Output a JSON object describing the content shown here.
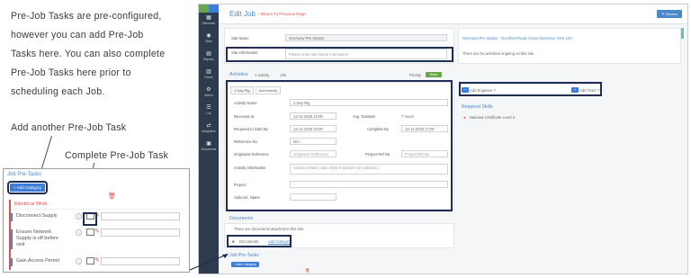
{
  "intro": {
    "lines": [
      "Pre-Job Tasks are pre-configured,",
      "however you can add Pre-Job",
      "Tasks here. You can also complete",
      "Pre-Job Tasks here prior to",
      "scheduling each Job."
    ]
  },
  "callouts": {
    "add": "Add another Pre-Job Task",
    "complete": "Complete Pre-Job Task"
  },
  "zoom": {
    "header": "Job Pre-Tasks",
    "add_button": "+ Add Category",
    "category": "Electrical Work",
    "tasks": [
      {
        "label": "Disconnect Supply"
      },
      {
        "label": "Ensure Network Supply is off before visit"
      },
      {
        "label": "Gain Access Permit"
      }
    ]
  },
  "app": {
    "sidebar": [
      {
        "icon": "calendar-icon",
        "glyph": "▦",
        "label": "Scheduler"
      },
      {
        "icon": "gauge-icon",
        "glyph": "◉",
        "label": "Sites"
      },
      {
        "icon": "report-icon",
        "glyph": "▤",
        "label": "Reports"
      },
      {
        "icon": "form-icon",
        "glyph": "▥",
        "label": "Forms"
      },
      {
        "icon": "admin-icon",
        "glyph": "⚙",
        "label": "Admin"
      },
      {
        "icon": "list-icon",
        "glyph": "☰",
        "label": "List"
      },
      {
        "icon": "integration-icon",
        "glyph": "⇄",
        "label": "Integration"
      },
      {
        "icon": "document-icon",
        "glyph": "▣",
        "label": "Documents"
      }
    ],
    "title": "Edit Job",
    "back_link": "‹ Return To Previous Page",
    "review_button": "✎ Review",
    "site_name_label": "Site Name",
    "site_name_value": "Overview Pre Station",
    "site_info_label": "Site Information",
    "site_info_placeholder": "Please enter Site Name information",
    "site_address": "Overview Pre Station - Overfield Road, Great Overview, OV9 1XX",
    "activities_note": "There are No activities ongoing on this site.",
    "activities_heading": "Activities",
    "activities_meta": "1 activity",
    "activities_count": "130",
    "priority_label": "Priority",
    "save_button": "Save",
    "tab_label": "1 Day Rig",
    "add_activity": "Add Activity",
    "form": {
      "activity_name_label": "Activity Name",
      "activity_name_value": "1 Day Rig",
      "received_label": "Received at",
      "received_value": "12-11-2020 10:00",
      "avg_duration_label": "Avg. Duration",
      "avg_duration_value": "7 hours",
      "required_start_label": "Required to Start By",
      "required_start_value": "12-11-2020 10:00",
      "complete_by_label": "Complete By",
      "complete_by_value": "12-11-2020 17:00",
      "reference_label": "Reference No",
      "reference_value": "N/A",
      "originator_label": "Originator Reference",
      "originator_placeholder": "Originator Reference",
      "project_ref_label": "Project Ref No",
      "project_ref_placeholder": "Project Ref No",
      "activity_info_label": "Activity Information",
      "activity_info_placeholder": "Activity Details (Upto 4000 characters are allowed.)",
      "project_label": "Project",
      "subcontractor_label": "Subcont. Name"
    },
    "add_engineer": "Add Engineer ?",
    "add_team": "Add Team ?",
    "required_skills_heading": "Required Skills",
    "skill": "National Certificate Level 3",
    "documents_heading": "Documents",
    "documents_note": "There are documents attached to this site.",
    "documents_row_label": "Documents",
    "documents_link": "Add Category",
    "prejob_heading": "Job Pre-Tasks",
    "prejob_button": "+ Add Category"
  }
}
